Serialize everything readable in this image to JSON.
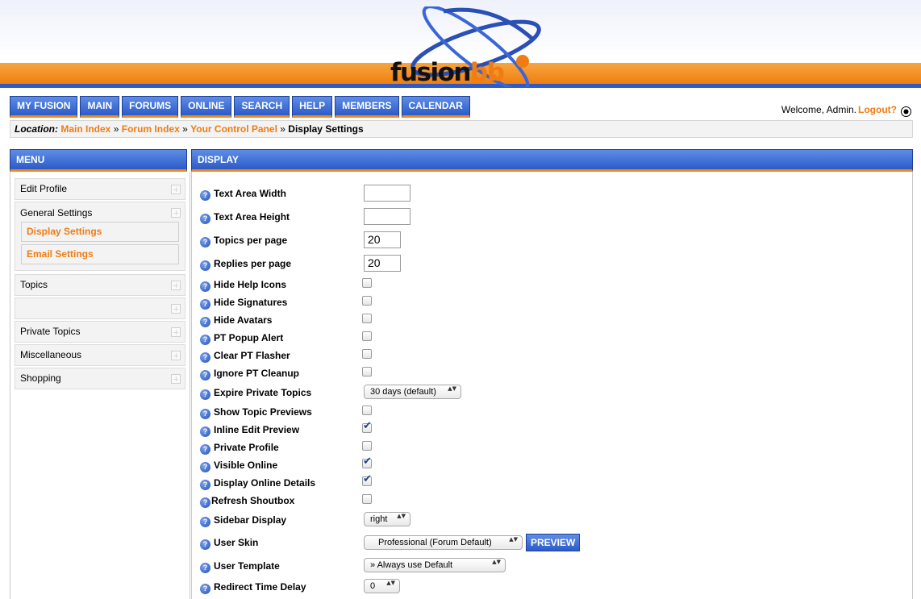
{
  "logo": {
    "fusion": "fusion",
    "bb": "bb"
  },
  "nav": {
    "items": [
      "MY FUSION",
      "MAIN",
      "FORUMS",
      "ONLINE",
      "SEARCH",
      "HELP",
      "MEMBERS",
      "CALENDAR"
    ]
  },
  "welcome": {
    "text": "Welcome, Admin.",
    "logout": "Logout?"
  },
  "breadcrumb": {
    "label": "Location:",
    "links": [
      "Main Index",
      "Forum Index",
      "Your Control Panel"
    ],
    "separator": "»",
    "current": "Display Settings"
  },
  "menu": {
    "title": "MENU",
    "items": {
      "edit_profile": "Edit Profile",
      "general_settings": "General Settings",
      "display_settings": "Display Settings",
      "email_settings": "Email Settings",
      "topics": "Topics",
      "private_topics": "Private Topics",
      "miscellaneous": "Miscellaneous",
      "shopping": "Shopping"
    }
  },
  "display": {
    "title": "DISPLAY",
    "help_glyph": "?",
    "labels": {
      "text_area_width": "Text Area Width",
      "text_area_height": "Text Area Height",
      "topics_per_page": "Topics per page",
      "replies_per_page": "Replies per page",
      "hide_help_icons": "Hide Help Icons",
      "hide_signatures": "Hide Signatures",
      "hide_avatars": "Hide Avatars",
      "pt_popup_alert": "PT Popup Alert",
      "clear_pt_flasher": "Clear PT Flasher",
      "ignore_pt_cleanup": "Ignore PT Cleanup",
      "expire_private_topics": "Expire Private Topics",
      "show_topic_previews": "Show Topic Previews",
      "inline_edit_preview": "Inline Edit Preview",
      "private_profile": "Private Profile",
      "visible_online": "Visible Online",
      "display_online_details": "Display Online Details",
      "refresh_shoutbox": "Refresh Shoutbox",
      "sidebar_display": "Sidebar Display",
      "user_skin": "User Skin",
      "user_template": "User Template",
      "redirect_time_delay": "Redirect Time Delay"
    },
    "values": {
      "text_area_width": "",
      "text_area_height": "",
      "topics_per_page": "20",
      "replies_per_page": "20",
      "expire_private_topics": "30 days (default)",
      "sidebar_display": "right",
      "user_skin": "Professional (Forum Default)",
      "user_template": "» Always use Default",
      "redirect_time_delay": "0"
    },
    "checked": {
      "hide_help_icons": false,
      "hide_signatures": false,
      "hide_avatars": false,
      "pt_popup_alert": false,
      "clear_pt_flasher": false,
      "ignore_pt_cleanup": false,
      "show_topic_previews": false,
      "inline_edit_preview": true,
      "private_profile": false,
      "visible_online": true,
      "display_online_details": true,
      "refresh_shoutbox": false
    },
    "preview_label": "PREVIEW",
    "select_arrows": "▲▼"
  },
  "colors": {
    "accent_orange": "#f07c12",
    "nav_blue": "#2c5bc9",
    "header_blue_line": "#2f58c8"
  }
}
